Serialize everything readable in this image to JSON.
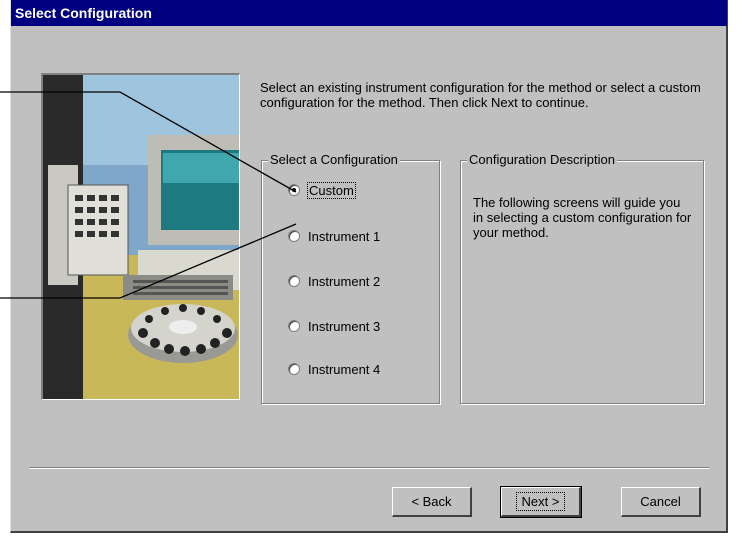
{
  "window": {
    "title": "Select Configuration"
  },
  "intro": "Select an existing instrument configuration for the method or select a custom configuration for the method. Then click Next to continue.",
  "config_group": {
    "label": "Select a Configuration",
    "options": [
      {
        "label": "Custom",
        "checked": true
      },
      {
        "label": "Instrument 1",
        "checked": false
      },
      {
        "label": "Instrument 2",
        "checked": false
      },
      {
        "label": "Instrument 3",
        "checked": false
      },
      {
        "label": "Instrument 4",
        "checked": false
      }
    ]
  },
  "description_group": {
    "label": "Configuration Description",
    "text": "The following screens will guide you in selecting a custom configuration for your method."
  },
  "buttons": {
    "back": "< Back",
    "next": "Next >",
    "cancel": "Cancel"
  },
  "colors": {
    "title_bar": "#000080",
    "dialog_face": "#c0c0c0"
  }
}
